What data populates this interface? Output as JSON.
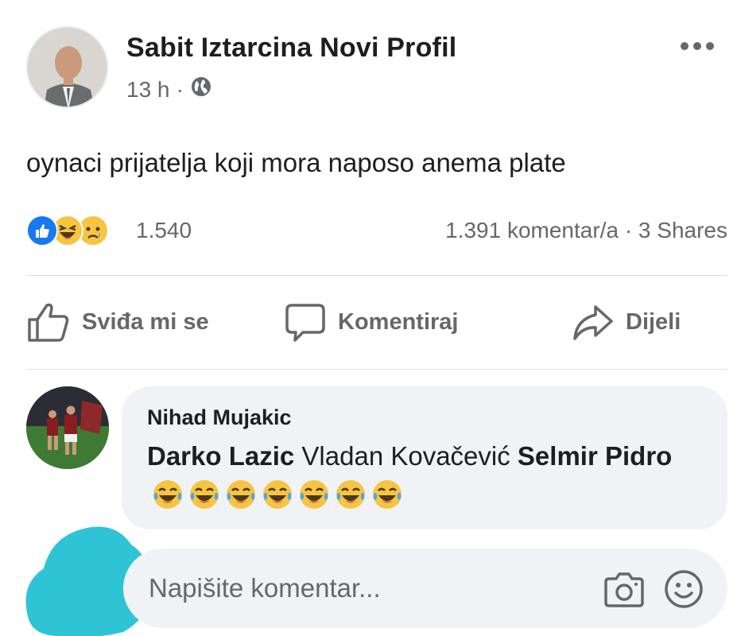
{
  "post": {
    "author": "Sabit Iztarcina Novi Profil",
    "time": "13 h",
    "separator": "·",
    "privacy_icon": "globe-icon",
    "text": "oynaci prijatelja koji mora naposo anema plate",
    "reaction_count": "1.540",
    "reaction_types": [
      "like",
      "haha",
      "sad"
    ],
    "comments_label": "1.391 komentar/a",
    "stats_separator": "·",
    "shares_label": "3 Shares"
  },
  "actions": {
    "like": "Sviđa mi se",
    "comment": "Komentiraj",
    "share": "Dijeli"
  },
  "comment": {
    "author": "Nihad Mujakic",
    "mention1": "Darko Lazic",
    "plain": "Vladan Kovačević",
    "mention2": "Selmir Pidro",
    "emoji_count": 7,
    "emoji": "laughing-tears"
  },
  "composer": {
    "placeholder": "Napišite komentar..."
  },
  "colors": {
    "like_blue": "#1877f2",
    "secondary_text": "#65676b",
    "bubble_bg": "#f0f2f5",
    "emoji_yellow": "#f7c542",
    "cyan_scribble": "#2ec4d6"
  }
}
